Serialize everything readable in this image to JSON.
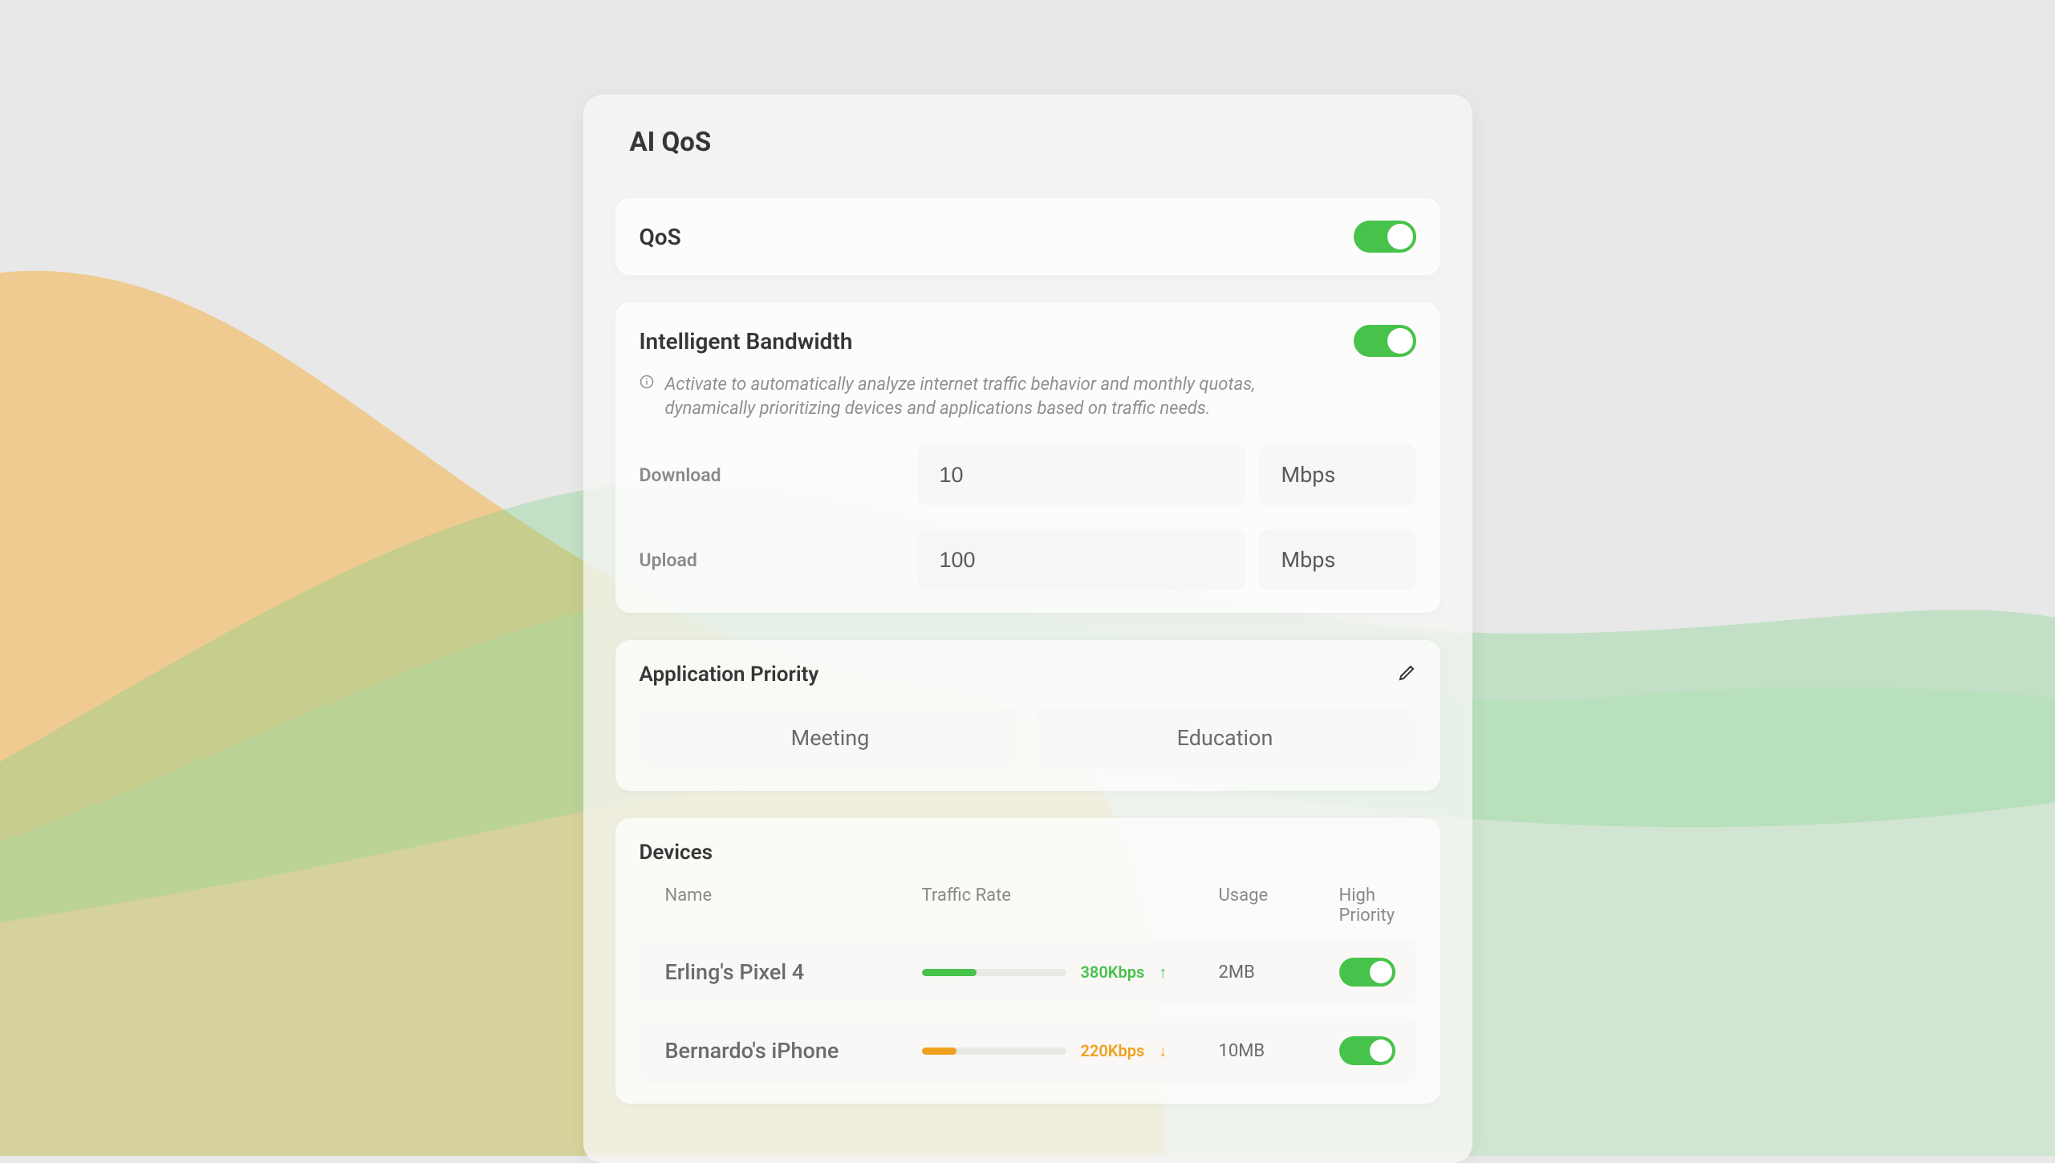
{
  "page_title": "AI QoS",
  "qos": {
    "label": "QoS",
    "enabled": true
  },
  "intelligent_bandwidth": {
    "label": "Intelligent Bandwidth",
    "enabled": true,
    "info": "Activate to automatically analyze internet traffic behavior and monthly quotas, dynamically prioritizing devices and applications based on traffic needs.",
    "download_label": "Download",
    "download_value": "10",
    "upload_label": "Upload",
    "upload_value": "100",
    "unit": "Mbps"
  },
  "app_priority": {
    "label": "Application Priority",
    "apps": [
      {
        "label": "Meeting"
      },
      {
        "label": "Education"
      }
    ]
  },
  "devices_section": {
    "label": "Devices",
    "columns": {
      "name": "Name",
      "rate": "Traffic Rate",
      "usage": "Usage",
      "priority": "High Priority"
    },
    "rows": [
      {
        "name": "Erling's Pixel 4",
        "rate_text": "380Kbps",
        "rate_pct": 38,
        "rate_color": "green",
        "arrow": "↑",
        "usage": "2MB",
        "priority": true
      },
      {
        "name": "Bernardo's iPhone",
        "rate_text": "220Kbps",
        "rate_pct": 24,
        "rate_color": "orange",
        "arrow": "↓",
        "usage": "10MB",
        "priority": true
      }
    ]
  },
  "colors": {
    "accent_green": "#47c24a",
    "accent_orange": "#f0a11f",
    "text_muted": "#8a8a8a"
  }
}
